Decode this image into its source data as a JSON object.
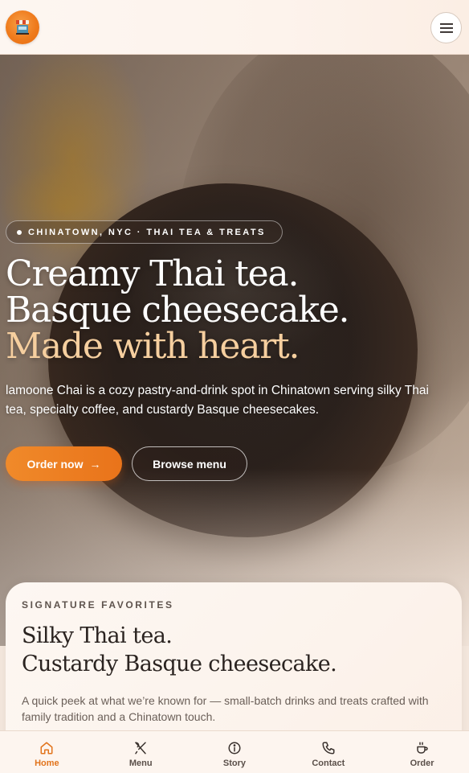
{
  "header": {
    "logo_icon": "food-stall-icon",
    "menu_icon": "hamburger-menu-icon"
  },
  "hero": {
    "badge": "CHINATOWN, NYC · THAI TEA & TREATS",
    "headline_line1": "Creamy Thai tea.",
    "headline_line2": "Basque cheesecake.",
    "headline_line3": "Made with heart.",
    "lead": "lamoone Chai is a cozy pastry-and-drink spot in Chinatown serving silky Thai tea, specialty coffee, and custardy Basque cheesecakes.",
    "order_button": "Order now",
    "order_arrow": "→",
    "browse_button": "Browse menu",
    "accent_color": "#f6cf9f"
  },
  "signature": {
    "eyebrow": "SIGNATURE FAVORITES",
    "title_line1": "Silky Thai tea.",
    "title_line2": "Custardy Basque cheesecake.",
    "description": "A quick peek at what we’re known for — small-batch drinks and treats crafted with family tradition and a Chinatown touch."
  },
  "bottom_nav": {
    "items": [
      {
        "label": "Home",
        "icon": "home-icon",
        "active": true
      },
      {
        "label": "Menu",
        "icon": "utensils-icon",
        "active": false
      },
      {
        "label": "Story",
        "icon": "info-icon",
        "active": false
      },
      {
        "label": "Contact",
        "icon": "phone-icon",
        "active": false
      },
      {
        "label": "Order",
        "icon": "coffee-cup-icon",
        "active": false
      }
    ]
  },
  "colors": {
    "brand_orange": "#ef7b1c",
    "active_nav": "#e2741c"
  }
}
